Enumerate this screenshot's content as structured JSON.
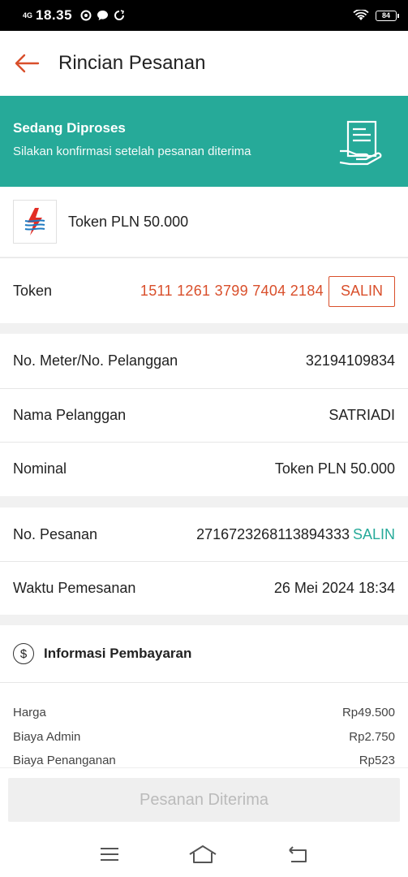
{
  "status_bar": {
    "network": "4G",
    "time": "18.35",
    "battery": "84"
  },
  "header": {
    "title": "Rincian Pesanan"
  },
  "status_banner": {
    "title": "Sedang Diproses",
    "subtitle": "Silakan konfirmasi setelah pesanan diterima"
  },
  "product": {
    "name": "Token PLN 50.000"
  },
  "token": {
    "label": "Token",
    "value": "1511 1261 3799 7404 2184",
    "copy_label": "SALIN"
  },
  "meter_details": [
    {
      "label": "No. Meter/No. Pelanggan",
      "value": "32194109834"
    },
    {
      "label": "Nama Pelanggan",
      "value": "SATRIADI"
    },
    {
      "label": "Nominal",
      "value": "Token PLN 50.000"
    }
  ],
  "order": {
    "number_label": "No. Pesanan",
    "number_value": "2716723268113894333",
    "copy_label": "SALIN",
    "time_label": "Waktu Pemesanan",
    "time_value": "26 Mei 2024 18:34"
  },
  "payment": {
    "title": "Informasi Pembayaran",
    "icon_glyph": "$",
    "lines": [
      {
        "label": "Harga",
        "value": "Rp49.500"
      },
      {
        "label": "Biaya Admin",
        "value": "Rp2.750"
      },
      {
        "label": "Biaya Penanganan",
        "value": "Rp523"
      }
    ]
  },
  "footer": {
    "confirm_button": "Pesanan Diterima"
  },
  "colors": {
    "accent_teal": "#26aa99",
    "accent_orange": "#d94f2b"
  }
}
